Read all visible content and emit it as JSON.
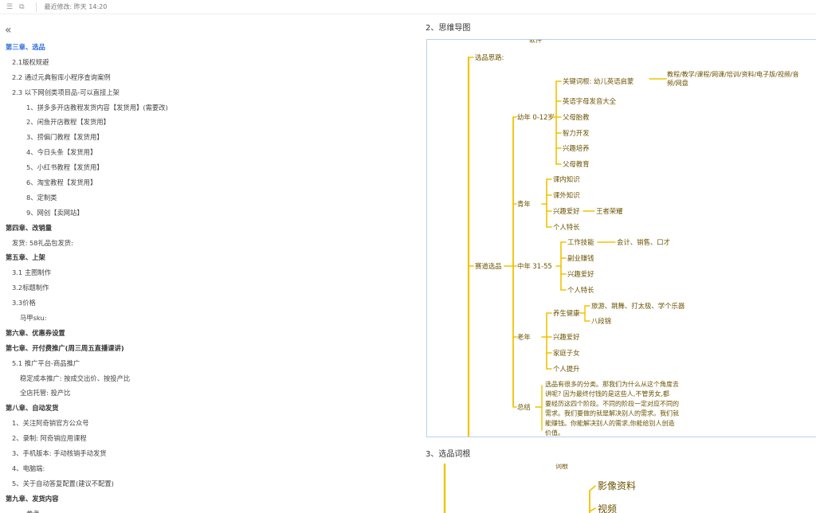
{
  "topbar": {
    "icons": [
      "outline-toggle-icon",
      "share-icon"
    ],
    "last_modified": "最近修改: 昨天 14:20"
  },
  "outline": {
    "collapse_glyph": "«",
    "items": [
      {
        "text": "第三章、选品",
        "level": 0,
        "style": "active"
      },
      {
        "text": "2.1版权规避",
        "level": 1
      },
      {
        "text": "2.2 通过元典智库小程序查询案例",
        "level": 1
      },
      {
        "text": "2.3 以下网创类项目品-可以直接上架",
        "level": 1
      },
      {
        "text": "1、拼多多开店教程发货内容【发货用】(需要改)",
        "level": 3
      },
      {
        "text": "2、闲鱼开店教程【发货用】",
        "level": 3
      },
      {
        "text": "3、捞偏门教程【发货用】",
        "level": 3
      },
      {
        "text": "4、今日头条【发货用】",
        "level": 3
      },
      {
        "text": "5、小红书教程【发货用】",
        "level": 3
      },
      {
        "text": "6、淘宝教程【发货用】",
        "level": 3
      },
      {
        "text": "8、定制类",
        "level": 3
      },
      {
        "text": "9、网创【卖网站】",
        "level": 3
      },
      {
        "text": "第四章、改销量",
        "level": 0,
        "style": "ch"
      },
      {
        "text": "发货: 58礼品包发货:",
        "level": 1
      },
      {
        "text": "第五章、上架",
        "level": 0,
        "style": "ch"
      },
      {
        "text": "3.1 主图制作",
        "level": 1
      },
      {
        "text": "3.2标题制作",
        "level": 1
      },
      {
        "text": "3.3价格",
        "level": 1
      },
      {
        "text": "马甲sku:",
        "level": 2
      },
      {
        "text": "第六章、优惠券设置",
        "level": 0,
        "style": "ch"
      },
      {
        "text": "第七章、开付费推广(周三周五直播课讲)",
        "level": 0,
        "style": "ch"
      },
      {
        "text": "5.1 推广平台-商品推广",
        "level": 1
      },
      {
        "text": "稳定成本推广: 按成交出价、按投产比",
        "level": 2
      },
      {
        "text": "全店托管: 投产比",
        "level": 2
      },
      {
        "text": "第八章、自动发货",
        "level": 0,
        "style": "ch"
      },
      {
        "text": "1、关注阿奇销官方公众号",
        "level": 1
      },
      {
        "text": "2、录制: 阿奇销应用课程",
        "level": 1
      },
      {
        "text": "3、手机版本: 手动核销手动发货",
        "level": 1
      },
      {
        "text": "4、电脑端:",
        "level": 1
      },
      {
        "text": "5、关于自动答复配置(建议不配置)",
        "level": 1
      },
      {
        "text": "第九章、发货内容",
        "level": 0,
        "style": "ch"
      },
      {
        "text": "参考一:",
        "level": 3
      }
    ]
  },
  "document": {
    "section2_title": "2、思维导图",
    "section3_title": "3、选品词根",
    "mindmap": {
      "top_cut": "软件",
      "root": "选品思路:",
      "branch": "赛道选品",
      "groups": [
        {
          "label": "幼年 0-12岁",
          "items": [
            "关键词根: 幼儿英语启蒙",
            "英语字母发音大全",
            "父母胎教",
            "智力开发",
            "兴趣培养",
            "父母教育"
          ],
          "extra": [
            "教程/教学/课程/网课/培训/资料/电子版/视频/音",
            "频/网盘"
          ]
        },
        {
          "label": "青年",
          "items": [
            "课内知识",
            "课外知识",
            "兴趣爱好",
            "个人特长"
          ],
          "extra": [
            "王者荣耀"
          ]
        },
        {
          "label": "中年 31-55",
          "items": [
            "工作技能",
            "副业赚钱",
            "兴趣爱好",
            "个人特长"
          ],
          "extra": [
            "会计、销售、口才"
          ]
        },
        {
          "label": "老年",
          "items": [
            "养生健康",
            "兴趣爱好",
            "家庭子女",
            "个人提升"
          ],
          "extra": [
            "旅游、跳舞、打太极、学个乐器",
            "八段锦"
          ]
        },
        {
          "label": "总结",
          "items": [],
          "extra": [
            "选品有很多的分类。那我们为什么从这个角度去",
            "讲呢? 因为最终付钱的是这些人,不管男女,都",
            "要经历这四个阶段。不同的阶段一定对应不同的",
            "需求。我们要做的就是解决别人的需求。我们就",
            "能赚钱。你能解决别人的需求,你能给别人创造",
            "价值。"
          ]
        }
      ]
    },
    "mindmap2": {
      "top_cut": "词根",
      "items": [
        "影像资料",
        "视频"
      ]
    },
    "accent_color": "#f2c200"
  }
}
